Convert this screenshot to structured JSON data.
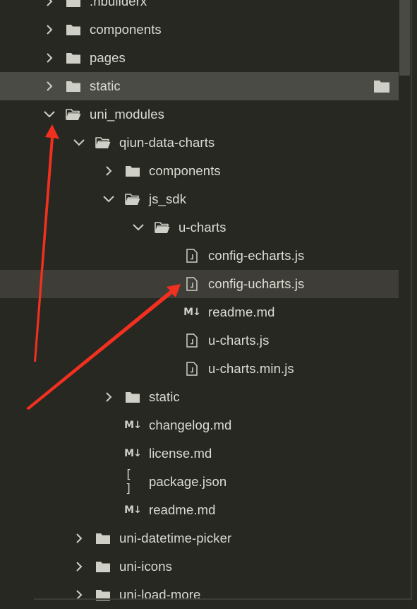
{
  "colors": {
    "background": "#272822",
    "selected_row": "#4b4b45",
    "hover_row": "#3e3d37",
    "text": "#dcdcd4",
    "annotation_arrow": "#f2301f"
  },
  "tree": [
    {
      "label": ".hbuilderx",
      "depth": 0,
      "kind": "folder",
      "expanded": false,
      "name": "hbuilderx"
    },
    {
      "label": "components",
      "depth": 0,
      "kind": "folder",
      "expanded": false,
      "name": "components"
    },
    {
      "label": "pages",
      "depth": 0,
      "kind": "folder",
      "expanded": false,
      "name": "pages"
    },
    {
      "label": "static",
      "depth": 0,
      "kind": "folder",
      "expanded": false,
      "name": "static",
      "state": "selected",
      "trailing_icon": "folder-icon"
    },
    {
      "label": "uni_modules",
      "depth": 0,
      "kind": "folder",
      "expanded": true,
      "name": "uni-modules"
    },
    {
      "label": "qiun-data-charts",
      "depth": 1,
      "kind": "folder",
      "expanded": true,
      "name": "qiun-data-charts"
    },
    {
      "label": "components",
      "depth": 2,
      "kind": "folder",
      "expanded": false,
      "name": "qiun-components"
    },
    {
      "label": "js_sdk",
      "depth": 2,
      "kind": "folder",
      "expanded": true,
      "name": "js-sdk"
    },
    {
      "label": "u-charts",
      "depth": 3,
      "kind": "folder",
      "expanded": true,
      "name": "u-charts-folder"
    },
    {
      "label": "config-echarts.js",
      "depth": 4,
      "kind": "js",
      "name": "config-echarts-js"
    },
    {
      "label": "config-ucharts.js",
      "depth": 4,
      "kind": "js",
      "name": "config-ucharts-js",
      "state": "hover"
    },
    {
      "label": "readme.md",
      "depth": 4,
      "kind": "md",
      "name": "u-charts-readme-md"
    },
    {
      "label": "u-charts.js",
      "depth": 4,
      "kind": "js",
      "name": "u-charts-js"
    },
    {
      "label": "u-charts.min.js",
      "depth": 4,
      "kind": "js",
      "name": "u-charts-min-js"
    },
    {
      "label": "static",
      "depth": 2,
      "kind": "folder",
      "expanded": false,
      "name": "qiun-static"
    },
    {
      "label": "changelog.md",
      "depth": 2,
      "kind": "md",
      "name": "changelog-md"
    },
    {
      "label": "license.md",
      "depth": 2,
      "kind": "md",
      "name": "license-md"
    },
    {
      "label": "package.json",
      "depth": 2,
      "kind": "json",
      "name": "package-json"
    },
    {
      "label": "readme.md",
      "depth": 2,
      "kind": "md",
      "name": "qiun-readme-md"
    },
    {
      "label": "uni-datetime-picker",
      "depth": 1,
      "kind": "folder",
      "expanded": false,
      "name": "uni-datetime-picker"
    },
    {
      "label": "uni-icons",
      "depth": 1,
      "kind": "folder",
      "expanded": false,
      "name": "uni-icons"
    },
    {
      "label": "uni-load-more",
      "depth": 1,
      "kind": "folder",
      "expanded": false,
      "name": "uni-load-more"
    }
  ],
  "glyphs": {
    "markdown": "M↓",
    "json": "[ ]"
  },
  "annotations": [
    {
      "name": "annotation-arrow-uni-modules",
      "points_to": "uni_modules"
    },
    {
      "name": "annotation-arrow-config-ucharts",
      "points_to": "config-ucharts.js"
    }
  ]
}
